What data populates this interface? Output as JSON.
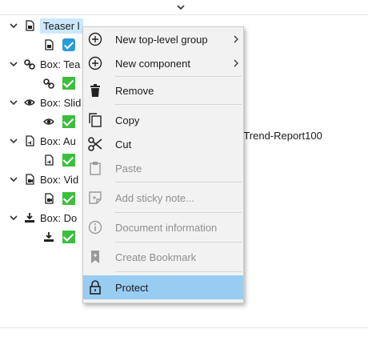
{
  "tree": {
    "items": [
      {
        "label": "Teaser l",
        "icon": "document-icon",
        "child_icon": "document-icon",
        "child_state": "blue-check"
      },
      {
        "label": "Box: Tea",
        "icon": "link-icon",
        "child_icon": "link-icon",
        "child_state": "green-check"
      },
      {
        "label": "Box: Slid",
        "icon": "eye-icon",
        "child_icon": "eye-icon",
        "child_state": "green-check"
      },
      {
        "label": "Box: Au",
        "icon": "audio-file-icon",
        "child_icon": "audio-file-icon",
        "child_state": "green-check"
      },
      {
        "label": "Box: Vid",
        "icon": "video-file-icon",
        "child_icon": "video-file-icon",
        "child_state": "green-check"
      },
      {
        "label": "Box: Do",
        "icon": "download-icon",
        "child_icon": "download-icon",
        "child_state": "green-check"
      }
    ],
    "row_text_right": "-Trend-Report100"
  },
  "context_menu": {
    "items": [
      {
        "label": "New top-level group",
        "icon": "plus-circle-icon",
        "submenu": true,
        "enabled": true
      },
      {
        "label": "New component",
        "icon": "plus-circle-icon",
        "submenu": true,
        "enabled": true
      },
      {
        "label": "Remove",
        "icon": "trash-icon",
        "submenu": false,
        "enabled": true
      },
      {
        "label": "Copy",
        "icon": "copy-icon",
        "submenu": false,
        "enabled": true
      },
      {
        "label": "Cut",
        "icon": "scissors-icon",
        "submenu": false,
        "enabled": true
      },
      {
        "label": "Paste",
        "icon": "clipboard-icon",
        "submenu": false,
        "enabled": false
      },
      {
        "label": "Add sticky note...",
        "icon": "sticky-note-icon",
        "submenu": false,
        "enabled": false
      },
      {
        "label": "Document information",
        "icon": "info-icon",
        "submenu": false,
        "enabled": false
      },
      {
        "label": "Create Bookmark",
        "icon": "bookmark-icon",
        "submenu": false,
        "enabled": false
      },
      {
        "label": "Protect",
        "icon": "lock-icon",
        "submenu": false,
        "enabled": true,
        "highlighted": true
      }
    ]
  },
  "colors": {
    "highlight": "#99ccf1",
    "check_green": "#3dbe3d",
    "check_blue": "#2a9bd8",
    "disabled_text": "#8f8f8f"
  }
}
